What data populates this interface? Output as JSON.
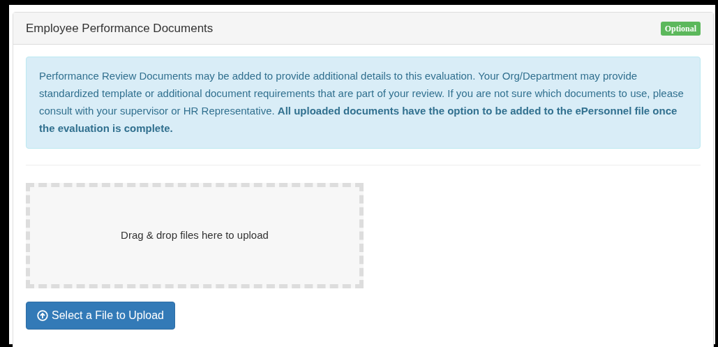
{
  "panel": {
    "title": "Employee Performance Documents",
    "badge": "Optional"
  },
  "info": "Performance Review Documents may be added to provide additional details to this evaluation. Your Org/Department may provide standardized template or additional document requirements that are part of your review. If you are not sure which documents to use, please consult with your supervisor or HR Representative. **All uploaded documents have the option to be added to the ePersonnel file once the evaluation is complete.**",
  "dropzone": {
    "text": "Drag & drop files here to upload"
  },
  "upload_button": "Select a File to Upload"
}
